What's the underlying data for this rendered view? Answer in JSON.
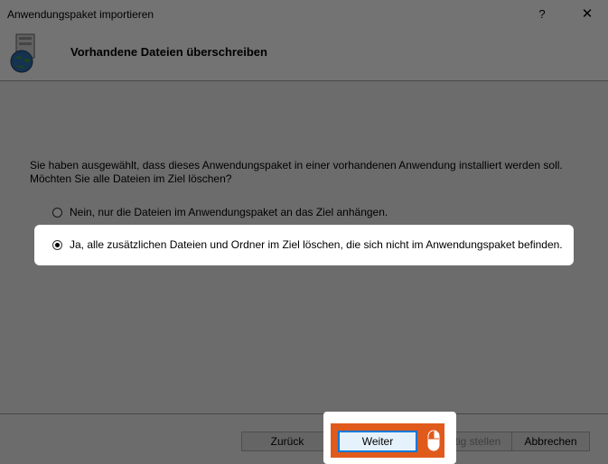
{
  "window": {
    "title": "Anwendungspaket importieren",
    "help_label": "?",
    "close_label": "✕"
  },
  "header": {
    "title": "Vorhandene Dateien überschreiben"
  },
  "body": {
    "description_line1": "Sie haben ausgewählt, dass dieses Anwendungspaket in einer vorhandenen Anwendung installiert werden soll.",
    "description_line2": "Möchten Sie alle Dateien im Ziel löschen?",
    "options": [
      {
        "label": "Nein, nur die Dateien im Anwendungspaket an das Ziel anhängen.",
        "selected": false
      },
      {
        "label": "Ja, alle zusätzlichen Dateien und Ordner im Ziel löschen, die sich nicht im Anwendungspaket befinden.",
        "selected": true
      }
    ]
  },
  "buttons": {
    "back": "Zurück",
    "next": "Weiter",
    "finish": "Fertig stellen",
    "cancel": "Abbrechen"
  },
  "colors": {
    "highlight_frame": "#e05a1c",
    "focus_border": "#0078d7"
  }
}
